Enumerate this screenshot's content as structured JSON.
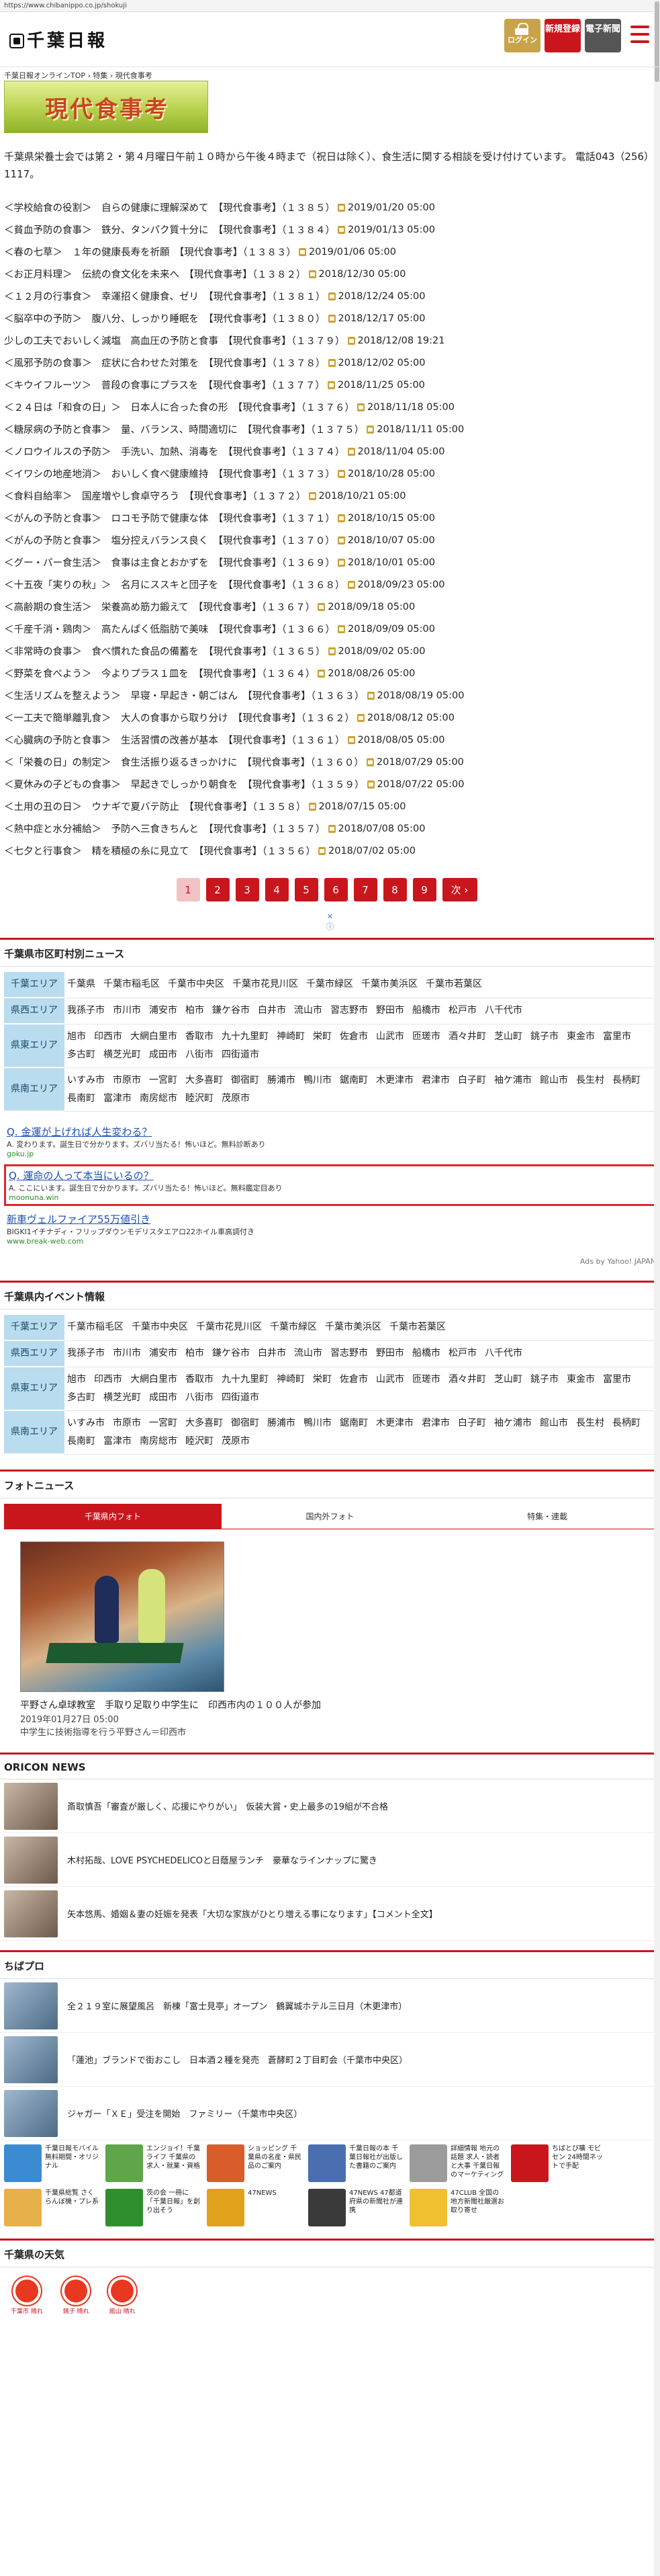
{
  "browser": {
    "url": "https://www.chibanippo.co.jp/shokuji"
  },
  "header": {
    "logo_text": "千葉日報",
    "login_label": "ログイン",
    "register_label": "新規登録",
    "paper_label": "電子新聞"
  },
  "breadcrumb": "千葉日報オンラインTOP › 特集 › 現代食事考",
  "page_title": "現代食事考",
  "intro": "千葉県栄養士会では第２・第４月曜日午前１０時から午後４時まで（祝日は除く）、食生活に関する相談を受け付けています。 電話043（256）1117。",
  "articles": [
    {
      "title": "＜学校給食の役割＞　自らの健康に理解深めて　【現代食事考】（１３８５）",
      "date": "2019/01/20 05:00"
    },
    {
      "title": "＜貧血予防の食事＞　鉄分、タンパク質十分に　【現代食事考】（１３８４）",
      "date": "2019/01/13 05:00"
    },
    {
      "title": "＜春の七草＞　１年の健康長寿を祈願　【現代食事考】（１３８３）",
      "date": "2019/01/06 05:00"
    },
    {
      "title": "＜お正月料理＞　伝統の食文化を未来へ　【現代食事考】（１３８２）",
      "date": "2018/12/30 05:00"
    },
    {
      "title": "＜１２月の行事食＞　幸運招く健康食、ゼリ　【現代食事考】（１３８１）",
      "date": "2018/12/24 05:00"
    },
    {
      "title": "＜脳卒中の予防＞　腹八分、しっかり睡眠を　【現代食事考】（１３８０）",
      "date": "2018/12/17 05:00"
    },
    {
      "title": "少しの工夫でおいしく減塩　高血圧の予防と食事　【現代食事考】（１３７９）",
      "date": "2018/12/08 19:21"
    },
    {
      "title": "＜風邪予防の食事＞　症状に合わせた対策を　【現代食事考】（１３７８）",
      "date": "2018/12/02 05:00"
    },
    {
      "title": "＜キウイフルーツ＞　普段の食事にプラスを　【現代食事考】（１３７７）",
      "date": "2018/11/25 05:00"
    },
    {
      "title": "＜２４日は「和食の日」＞　日本人に合った食の形　【現代食事考】（１３７６）",
      "date": "2018/11/18 05:00"
    },
    {
      "title": "＜糖尿病の予防と食事＞　量、バランス、時間適切に　【現代食事考】（１３７５）",
      "date": "2018/11/11 05:00"
    },
    {
      "title": "＜ノロウイルスの予防＞　手洗い、加熱、消毒を　【現代食事考】（１３７４）",
      "date": "2018/11/04 05:00"
    },
    {
      "title": "＜イワシの地産地消＞　おいしく食べ健康維持　【現代食事考】（１３７３）",
      "date": "2018/10/28 05:00"
    },
    {
      "title": "＜食料自給率＞　国産増やし食卓守ろう　【現代食事考】（１３７２）",
      "date": "2018/10/21 05:00"
    },
    {
      "title": "＜がんの予防と食事＞　ロコモ予防で健康な体　【現代食事考】（１３７１）",
      "date": "2018/10/15 05:00"
    },
    {
      "title": "＜がんの予防と食事＞　塩分控えバランス良く　【現代食事考】（１３７０）",
      "date": "2018/10/07 05:00"
    },
    {
      "title": "＜グー・パー食生活＞　食事は主食とおかずを　【現代食事考】（１３６９）",
      "date": "2018/10/01 05:00"
    },
    {
      "title": "＜十五夜「実りの秋」＞　名月にススキと団子を　【現代食事考】（１３６８）",
      "date": "2018/09/23 05:00"
    },
    {
      "title": "＜高齢期の食生活＞　栄養高め筋力鍛えて　【現代食事考】（１３６７）",
      "date": "2018/09/18 05:00"
    },
    {
      "title": "＜千産千消・鶏肉＞　高たんぱく低脂肪で美味　【現代食事考】（１３６６）",
      "date": "2018/09/09 05:00"
    },
    {
      "title": "＜非常時の食事＞　食べ慣れた食品の備蓄を　【現代食事考】（１３６５）",
      "date": "2018/09/02 05:00"
    },
    {
      "title": "＜野菜を食べよう＞　今よりプラス１皿を　【現代食事考】（１３６４）",
      "date": "2018/08/26 05:00"
    },
    {
      "title": "＜生活リズムを整えよう＞　早寝・早起き・朝ごはん　【現代食事考】（１３６３）",
      "date": "2018/08/19 05:00"
    },
    {
      "title": "＜一工夫で簡単離乳食＞　大人の食事から取り分け　【現代食事考】（１３６２）",
      "date": "2018/08/12 05:00"
    },
    {
      "title": "＜心臓病の予防と食事＞　生活習慣の改善が基本　【現代食事考】（１３６１）",
      "date": "2018/08/05 05:00"
    },
    {
      "title": "＜「栄養の日」の制定＞　食生活振り返るきっかけに　【現代食事考】（１３６０）",
      "date": "2018/07/29 05:00"
    },
    {
      "title": "＜夏休みの子どもの食事＞　早起きでしっかり朝食を　【現代食事考】（１３５９）",
      "date": "2018/07/22 05:00"
    },
    {
      "title": "＜土用の丑の日＞　ウナギで夏バテ防止　【現代食事考】（１３５８）",
      "date": "2018/07/15 05:00"
    },
    {
      "title": "＜熱中症と水分補給＞　予防へ三食きちんと　【現代食事考】（１３５７）",
      "date": "2018/07/08 05:00"
    },
    {
      "title": "＜七夕と行事食＞　精を積極の糸に見立て　【現代食事考】（１３５６）",
      "date": "2018/07/02 05:00"
    }
  ],
  "pager": {
    "pages": [
      "1",
      "2",
      "3",
      "4",
      "5",
      "6",
      "7",
      "8",
      "9"
    ],
    "current": "1",
    "next_label": "次 ›"
  },
  "municipal_news": {
    "title": "千葉県市区町村別ニュース",
    "rows": [
      {
        "label": "千葉エリア",
        "cities": [
          "千葉県",
          "千葉市稲毛区",
          "千葉市中央区",
          "千葉市花見川区",
          "千葉市緑区",
          "千葉市美浜区",
          "千葉市若葉区"
        ]
      },
      {
        "label": "県西エリア",
        "cities": [
          "我孫子市",
          "市川市",
          "浦安市",
          "柏市",
          "鎌ケ谷市",
          "白井市",
          "流山市",
          "習志野市",
          "野田市",
          "船橋市",
          "松戸市",
          "八千代市"
        ]
      },
      {
        "label": "県東エリア",
        "cities": [
          "旭市",
          "印西市",
          "大網白里市",
          "香取市",
          "九十九里町",
          "神崎町",
          "栄町",
          "佐倉市",
          "山武市",
          "匝瑳市",
          "酒々井町",
          "芝山町",
          "銚子市",
          "東金市",
          "富里市",
          "多古町",
          "横芝光町",
          "成田市",
          "八街市",
          "四街道市"
        ]
      },
      {
        "label": "県南エリア",
        "cities": [
          "いすみ市",
          "市原市",
          "一宮町",
          "大多喜町",
          "御宿町",
          "勝浦市",
          "鴨川市",
          "鋸南町",
          "木更津市",
          "君津市",
          "白子町",
          "袖ケ浦市",
          "館山市",
          "長生村",
          "長柄町",
          "長南町",
          "富津市",
          "南房総市",
          "睦沢町",
          "茂原市"
        ]
      }
    ]
  },
  "ads": {
    "items": [
      {
        "question": "Q. 金運が上げれば人生変わる？",
        "desc": "A. 変わります。誕生日で分かります。ズバリ当たる！怖いほど。無料診断あり",
        "url": "goku.jp"
      },
      {
        "question": "Q. 運命の人って本当にいるの？",
        "desc": "A. ここにいます。誕生日で分かります。ズバリ当たる！怖いほど。無料鑑定目あり",
        "url": "moonuna.win"
      },
      {
        "question": "新車ヴェルファイア55万値引き",
        "desc": "BIGKI1イチナディ・フリップダウンモデリスタエアロ22ホイル車高調付き",
        "url": "www.break-web.com"
      }
    ],
    "footer": "Ads by Yahoo! JAPAN"
  },
  "events": {
    "title": "千葉県内イベント情報",
    "rows": [
      {
        "label": "千葉エリア",
        "cities": [
          "千葉市稲毛区",
          "千葉市中央区",
          "千葉市花見川区",
          "千葉市緑区",
          "千葉市美浜区",
          "千葉市若葉区"
        ]
      },
      {
        "label": "県西エリア",
        "cities": [
          "我孫子市",
          "市川市",
          "浦安市",
          "柏市",
          "鎌ケ谷市",
          "白井市",
          "流山市",
          "習志野市",
          "野田市",
          "船橋市",
          "松戸市",
          "八千代市"
        ]
      },
      {
        "label": "県東エリア",
        "cities": [
          "旭市",
          "印西市",
          "大網白里市",
          "香取市",
          "九十九里町",
          "神崎町",
          "栄町",
          "佐倉市",
          "山武市",
          "匝瑳市",
          "酒々井町",
          "芝山町",
          "銚子市",
          "東金市",
          "富里市",
          "多古町",
          "横芝光町",
          "成田市",
          "八街市",
          "四街道市"
        ]
      },
      {
        "label": "県南エリア",
        "cities": [
          "いすみ市",
          "市原市",
          "一宮町",
          "大多喜町",
          "御宿町",
          "勝浦市",
          "鴨川市",
          "鋸南町",
          "木更津市",
          "君津市",
          "白子町",
          "袖ケ浦市",
          "館山市",
          "長生村",
          "長柄町",
          "長南町",
          "富津市",
          "南房総市",
          "睦沢町",
          "茂原市"
        ]
      }
    ]
  },
  "photo_news": {
    "title": "フォトニュース",
    "tabs": [
      "千葉県内フォト",
      "国内外フォト",
      "特集・連載"
    ],
    "caption": "平野さん卓球教室　手取り足取り中学生に　印西市内の１００人が参加",
    "date": "2019年01月27日 05:00",
    "subcaption": "中学生に技術指導を行う平野さん＝印西市"
  },
  "oricon": {
    "title": "ORICON NEWS",
    "items": [
      "斎取慎吾「審査が厳しく、応援にやりがい」　仮装大賞・史上最多の19組が不合格",
      "木村拓哉、LOVE PSYCHEDELICOと日蔭屋ランチ　豪華なラインナップに驚き",
      "矢本悠馬、婚姻＆妻の妊娠を発表「大切な家族がひとり増える事になります」【コメント全文】"
    ]
  },
  "chibapro": {
    "title": "ちばプロ",
    "items": [
      "全２１９室に展望風呂　新棟「富士見亭」オープン　鶴翼城ホテル三日月（木更津市）",
      "「蓮池」ブランドで街おこし　日本酒２種を発売　蒼酵町２丁目町会（千葉市中央区）",
      "ジャガー「ＸＥ」受注を開始　ファミリー（千葉市中央区）"
    ]
  },
  "tiles": [
    {
      "label": "千葉日報モバイル 無料期間・オリジナル",
      "color": "#3a8bd1"
    },
    {
      "label": "エンジョイ！千葉ライフ 千葉県の求人・就業・資格",
      "color": "#5fa54a"
    },
    {
      "label": "ショッピング 千葉県の名産・県民品のご案内",
      "color": "#d95c2b"
    },
    {
      "label": "千葉日報の本 千葉日報社が出版した書籍のご案内",
      "color": "#4a6fb0"
    },
    {
      "label": "詳細情報 地元の話題 求人・読者と大事 千葉日報のマーケティング",
      "color": "#9b9b9b"
    },
    {
      "label": "ちばとび嚝 モビセン 24時間ネットで手配",
      "color": "#c9161d"
    },
    {
      "label": "千葉県総覧 さくらんぼ機・プレ系",
      "color": "#e8b04b"
    },
    {
      "label": "茨の会 一冊に「千葉日報」を創り出そう",
      "color": "#2f8f2f"
    },
    {
      "label": "47NEWS",
      "color": "#e0a21a"
    },
    {
      "label": "47NEWS 47都道府県の新聞社が連携",
      "color": "#3a3a3a"
    },
    {
      "label": "47CLUB 全国の地方新聞社厳選お取り寄せ",
      "color": "#f0c030"
    }
  ],
  "weather": {
    "title": "千葉県の天気",
    "cells": [
      "千葉市 晴れ",
      "銚子 晴れ",
      "館山 晴れ"
    ]
  }
}
